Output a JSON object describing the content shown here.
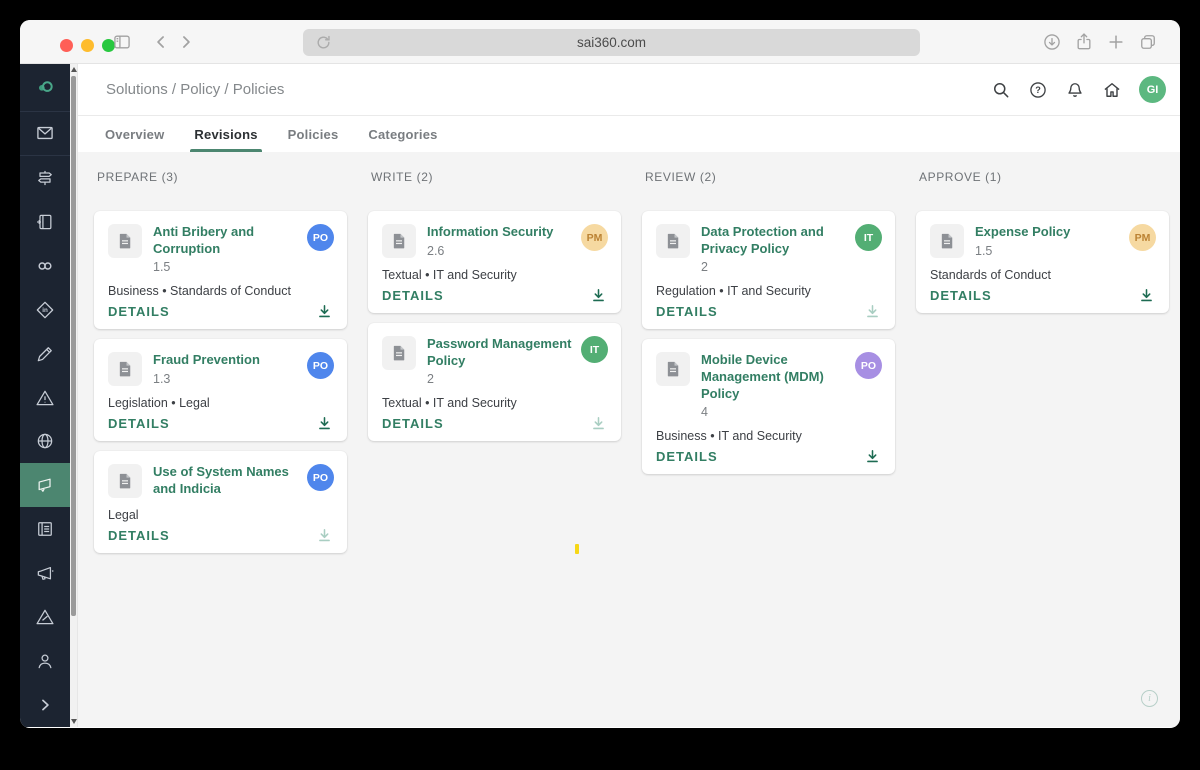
{
  "browser": {
    "url": "sai360.com",
    "traffic_lights": {
      "close": "#ff5f57",
      "minimize": "#febc2e",
      "zoom": "#28c840"
    }
  },
  "header": {
    "breadcrumb": "Solutions / Policy / Policies",
    "user_avatar": {
      "text": "GI",
      "bg": "#5cb880",
      "fg": "#ffffff"
    }
  },
  "tabs": [
    {
      "label": "Overview"
    },
    {
      "label": "Revisions"
    },
    {
      "label": "Policies"
    },
    {
      "label": "Categories"
    }
  ],
  "sidebar": {
    "color": "#1c2431",
    "active_color": "#4c8670",
    "items": [
      "logo",
      "mail",
      "signpost",
      "journal",
      "links",
      "diamond-in",
      "pencil",
      "warning",
      "globe",
      "policy (active)",
      "list",
      "megaphone",
      "warning-alt",
      "person",
      "expand"
    ]
  },
  "board": {
    "details_label": "DETAILS",
    "download_enabled_color": "#1d6b52",
    "download_disabled_color": "#a9cec2",
    "columns": [
      {
        "title": "PREPARE (3)",
        "cards": [
          {
            "title": "Anti Bribery and Corruption",
            "version": "1.5",
            "tags": "Business • Standards of Conduct",
            "avatar": {
              "text": "PO",
              "bg": "#4f86ec",
              "fg": "#ffffff"
            },
            "download_color": "#1d6b52"
          },
          {
            "title": "Fraud Prevention",
            "version": "1.3",
            "tags": "Legislation • Legal",
            "avatar": {
              "text": "PO",
              "bg": "#4f86ec",
              "fg": "#ffffff"
            },
            "download_color": "#1d6b52"
          },
          {
            "title": "Use of System Names and Indicia",
            "tags": "Legal",
            "avatar": {
              "text": "PO",
              "bg": "#4f86ec",
              "fg": "#ffffff"
            },
            "download_color": "#a9cec2"
          }
        ]
      },
      {
        "title": "WRITE (2)",
        "cards": [
          {
            "title": "Information Security",
            "version": "2.6",
            "tags": "Textual • IT and Security",
            "avatar": {
              "text": "PM",
              "bg": "#f6d9a1",
              "fg": "#bb8233"
            },
            "download_color": "#1d6b52"
          },
          {
            "title": "Password Management Policy",
            "version": "2",
            "tags": "Textual • IT and Security",
            "avatar": {
              "text": "IT",
              "bg": "#53ae74",
              "fg": "#ffffff"
            },
            "download_color": "#a9cec2"
          }
        ]
      },
      {
        "title": "REVIEW (2)",
        "cards": [
          {
            "title": "Data Protection and Privacy Policy",
            "version": "2",
            "tags": "Regulation • IT and Security",
            "avatar": {
              "text": "IT",
              "bg": "#53ae74",
              "fg": "#ffffff"
            },
            "download_color": "#a9cec2"
          },
          {
            "title": "Mobile Device Management (MDM) Policy",
            "version": "4",
            "tags": "Business • IT and Security",
            "avatar": {
              "text": "PO",
              "bg": "#a78fe3",
              "fg": "#ffffff"
            },
            "download_color": "#1d6b52"
          }
        ]
      },
      {
        "title": "APPROVE (1)",
        "cards": [
          {
            "title": "Expense Policy",
            "version": "1.5",
            "tags": "Standards of Conduct",
            "avatar": {
              "text": "PM",
              "bg": "#f6d9a1",
              "fg": "#bb8233"
            },
            "download_color": "#1d6b52"
          }
        ]
      }
    ]
  }
}
